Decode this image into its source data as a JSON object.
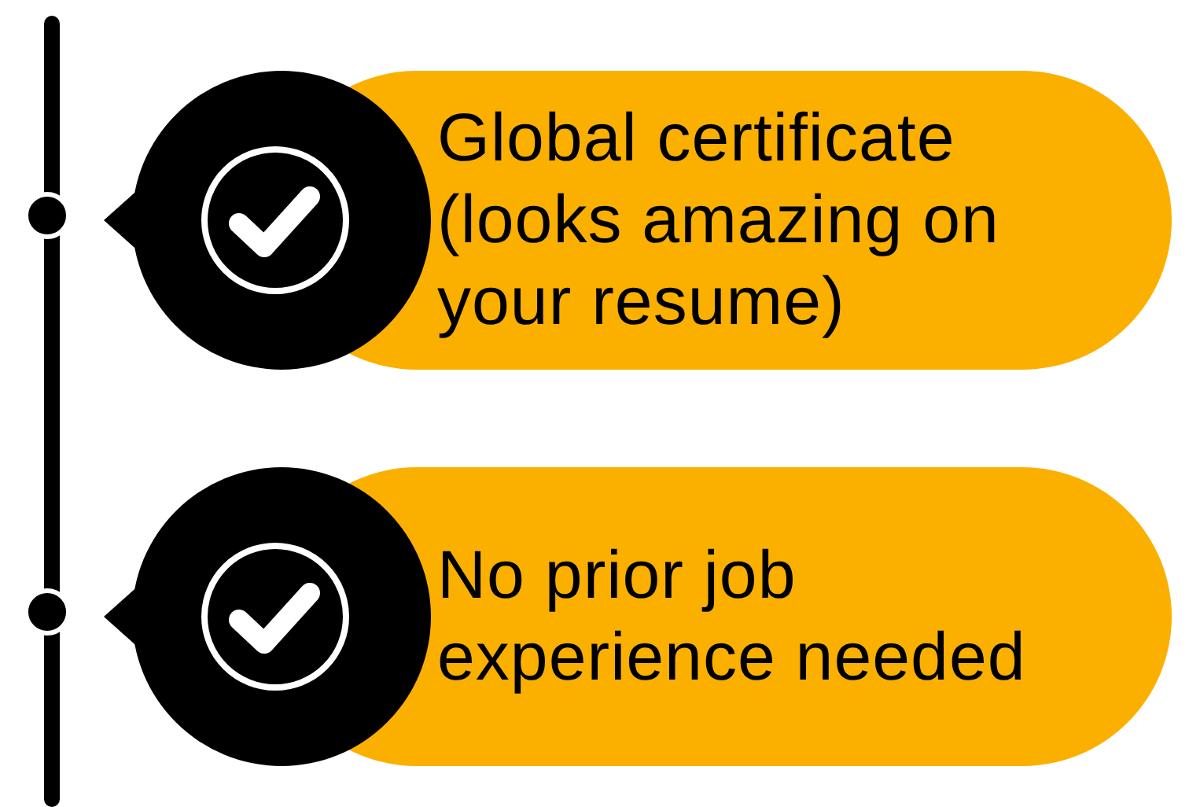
{
  "benefits": [
    {
      "text": "Global certificate (looks amazing on your resume)"
    },
    {
      "text": "No prior job experience needed"
    }
  ]
}
